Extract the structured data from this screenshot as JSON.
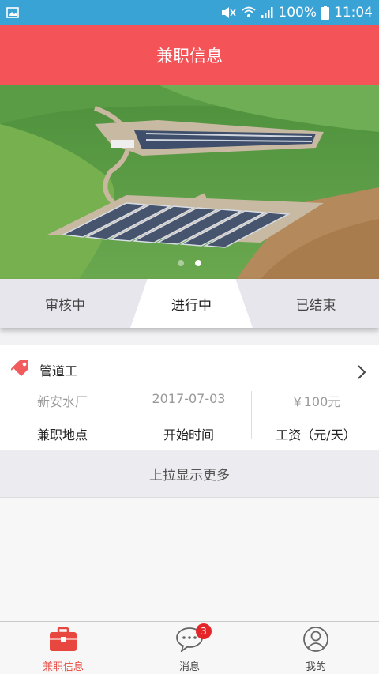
{
  "statusbar": {
    "battery": "100%",
    "time": "11:04"
  },
  "header": {
    "title": "兼职信息"
  },
  "banner": {
    "image_icon": "farm-aerial-photo"
  },
  "tabs": [
    {
      "label": "审核中"
    },
    {
      "label": "进行中"
    },
    {
      "label": "已结束"
    }
  ],
  "job": {
    "title": "管道工",
    "location": "新安水厂",
    "start_date": "2017-07-03",
    "salary": "￥100元",
    "location_label": "兼职地点",
    "start_label": "开始时间",
    "salary_label": "工资（元/天）"
  },
  "load_more": "上拉显示更多",
  "bottom_nav": {
    "items": [
      {
        "label": "兼职信息",
        "icon": "briefcase-icon"
      },
      {
        "label": "消息",
        "icon": "chat-icon",
        "badge": "3"
      },
      {
        "label": "我的",
        "icon": "user-icon"
      }
    ]
  },
  "colors": {
    "header": "#f45458",
    "statusbar": "#3aa3d6",
    "accent": "#e8473f"
  }
}
